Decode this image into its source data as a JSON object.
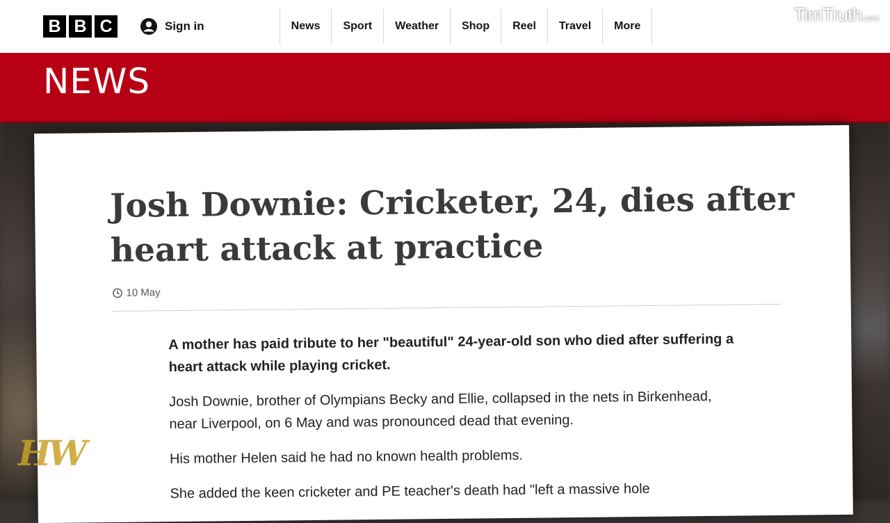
{
  "topbar": {
    "logo_letters": [
      "B",
      "B",
      "C"
    ],
    "signin_label": "Sign in",
    "nav_items": [
      "News",
      "Sport",
      "Weather",
      "Shop",
      "Reel",
      "Travel",
      "More"
    ]
  },
  "banner": {
    "section_title": "NEWS",
    "color": "#b80015"
  },
  "article": {
    "headline": "Josh Downie: Cricketer, 24, dies after heart attack at practice",
    "date": "10 May",
    "lead": "A mother has paid tribute to her \"beautiful\" 24-year-old son who died after suffering a heart attack while playing cricket.",
    "paragraphs": [
      "Josh Downie, brother of Olympians Becky and Ellie, collapsed in the nets in Birkenhead, near Liverpool, on 6 May and was pronounced dead that evening.",
      "His mother Helen said he had no known health problems.",
      "She added the keen cricketer and PE teacher's death had \"left a massive hole"
    ]
  },
  "watermarks": {
    "top_right": "TimTruth",
    "top_right_suffix": ".com",
    "bottom_left": "HW"
  },
  "icons": {
    "account": "account-icon",
    "clock": "clock-icon"
  }
}
